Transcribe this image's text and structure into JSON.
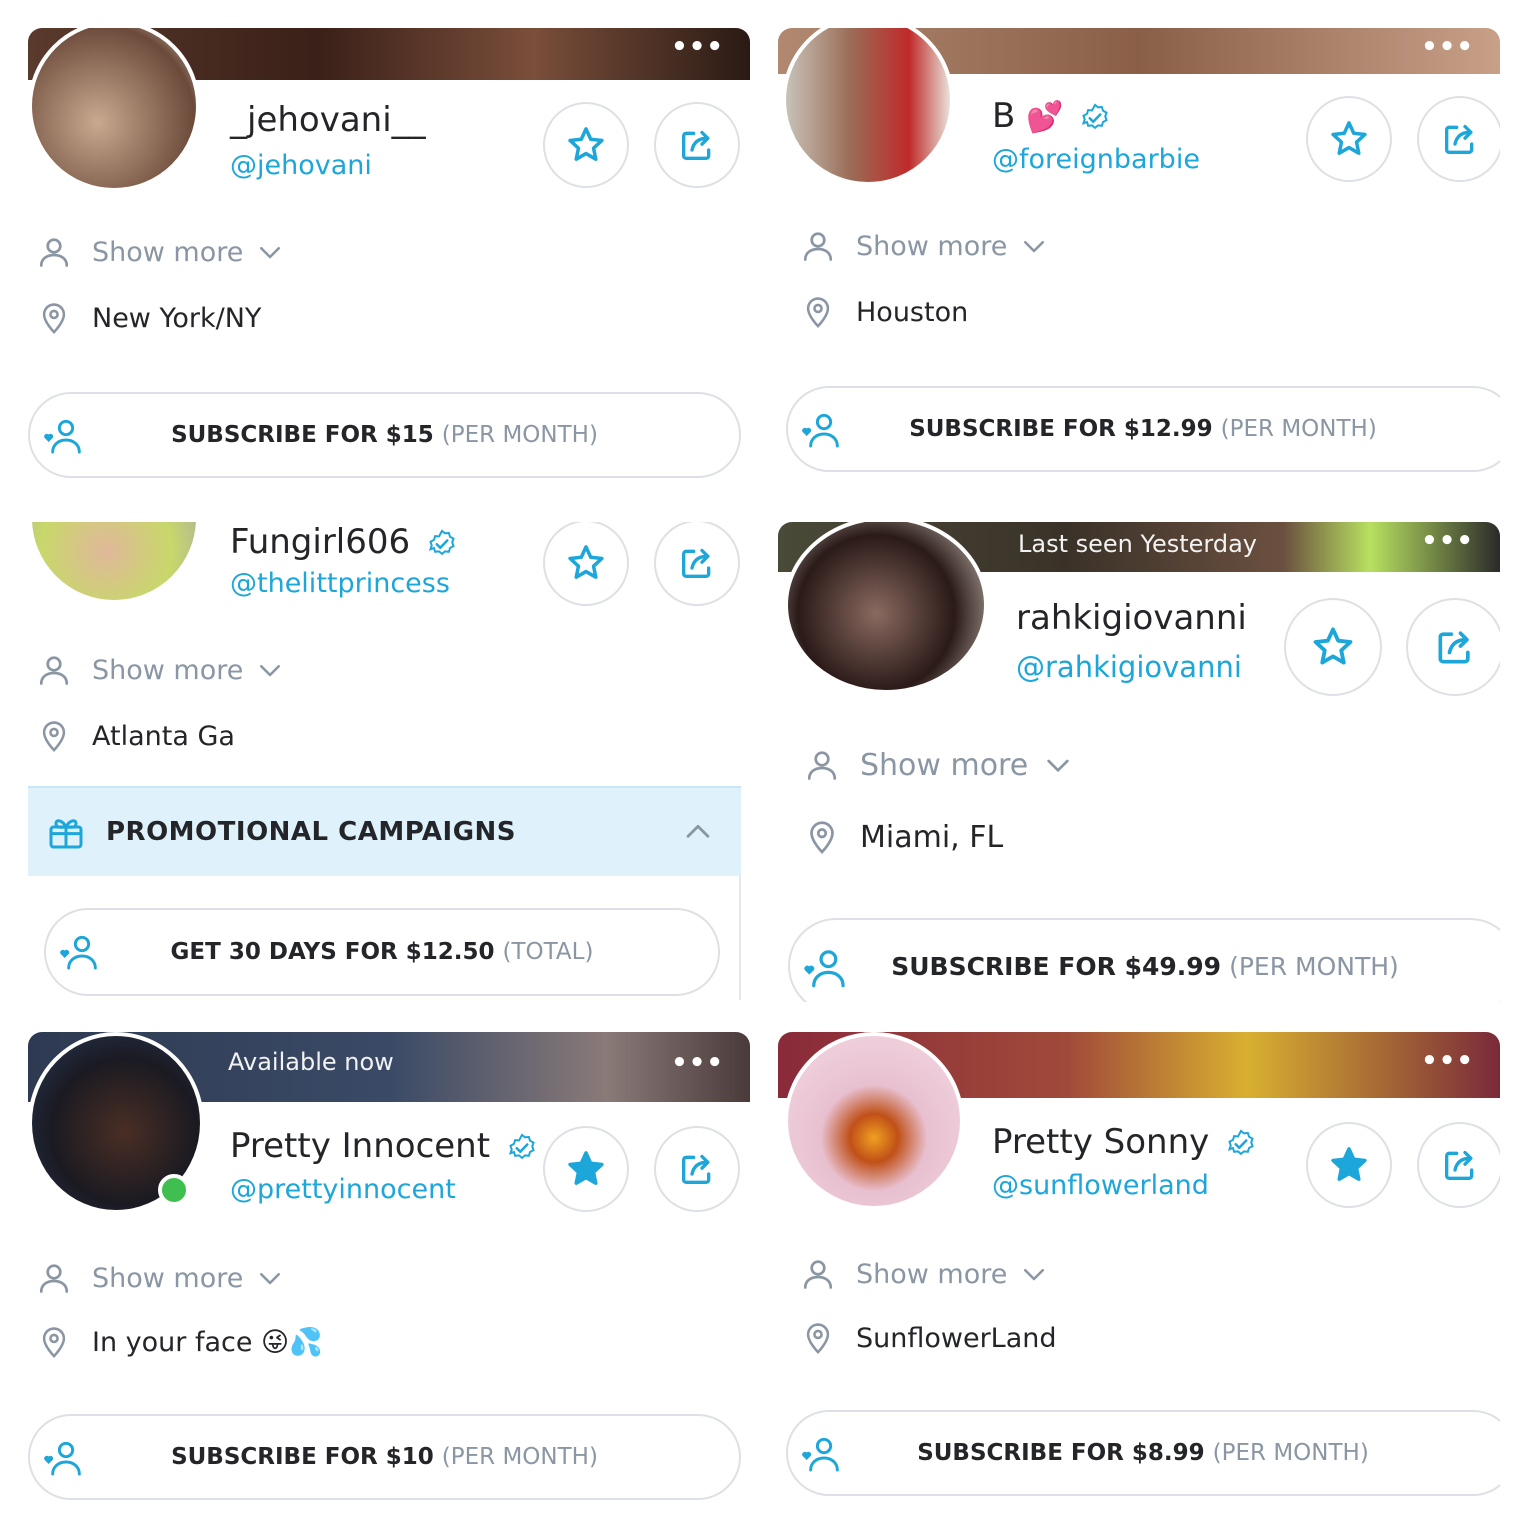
{
  "colors": {
    "accent": "#1da6d9",
    "muted": "#8a96a3",
    "online": "#3fbf4f",
    "promo_bg": "#dff2fb"
  },
  "common": {
    "show_more": "Show more",
    "menu_dots": "•••",
    "per_month": "(PER MONTH)"
  },
  "cards": [
    {
      "name": "_jehovani__",
      "handle": "@jehovani",
      "verified": false,
      "emoji": "",
      "status": "",
      "location": "New York/NY",
      "subscribe": "SUBSCRIBE FOR $15",
      "subscribe_suffix": "(PER MONTH)",
      "favorited": false
    },
    {
      "name": "B",
      "handle": "@foreignbarbie",
      "verified": true,
      "emoji": "💕",
      "status": "",
      "location": "Houston",
      "subscribe": "SUBSCRIBE FOR $12.99",
      "subscribe_suffix": "(PER MONTH)",
      "favorited": false
    },
    {
      "name": "Fungirl606",
      "handle": "@thelittprincess",
      "verified": true,
      "emoji": "",
      "status": "",
      "location": "Atlanta Ga",
      "promo_title": "PROMOTIONAL CAMPAIGNS",
      "subscribe": "GET 30 DAYS FOR $12.50",
      "subscribe_suffix": "(TOTAL)",
      "favorited": false
    },
    {
      "name": "rahkigiovanni",
      "handle": "@rahkigiovanni",
      "verified": false,
      "emoji": "",
      "status": "Last seen Yesterday",
      "location": "Miami, FL",
      "subscribe": "SUBSCRIBE FOR $49.99",
      "subscribe_suffix": "(PER MONTH)",
      "favorited": false
    },
    {
      "name": "Pretty Innocent",
      "handle": "@prettyinnocent",
      "verified": true,
      "emoji": "",
      "status": "Available now",
      "location": "In your face 😜💦",
      "subscribe": "SUBSCRIBE FOR $10",
      "subscribe_suffix": "(PER MONTH)",
      "favorited": true,
      "online": true
    },
    {
      "name": "Pretty Sonny",
      "handle": "@sunflowerland",
      "verified": true,
      "emoji": "",
      "status": "",
      "location": "SunflowerLand",
      "subscribe": "SUBSCRIBE FOR $8.99",
      "subscribe_suffix": "(PER MONTH)",
      "favorited": true
    }
  ]
}
